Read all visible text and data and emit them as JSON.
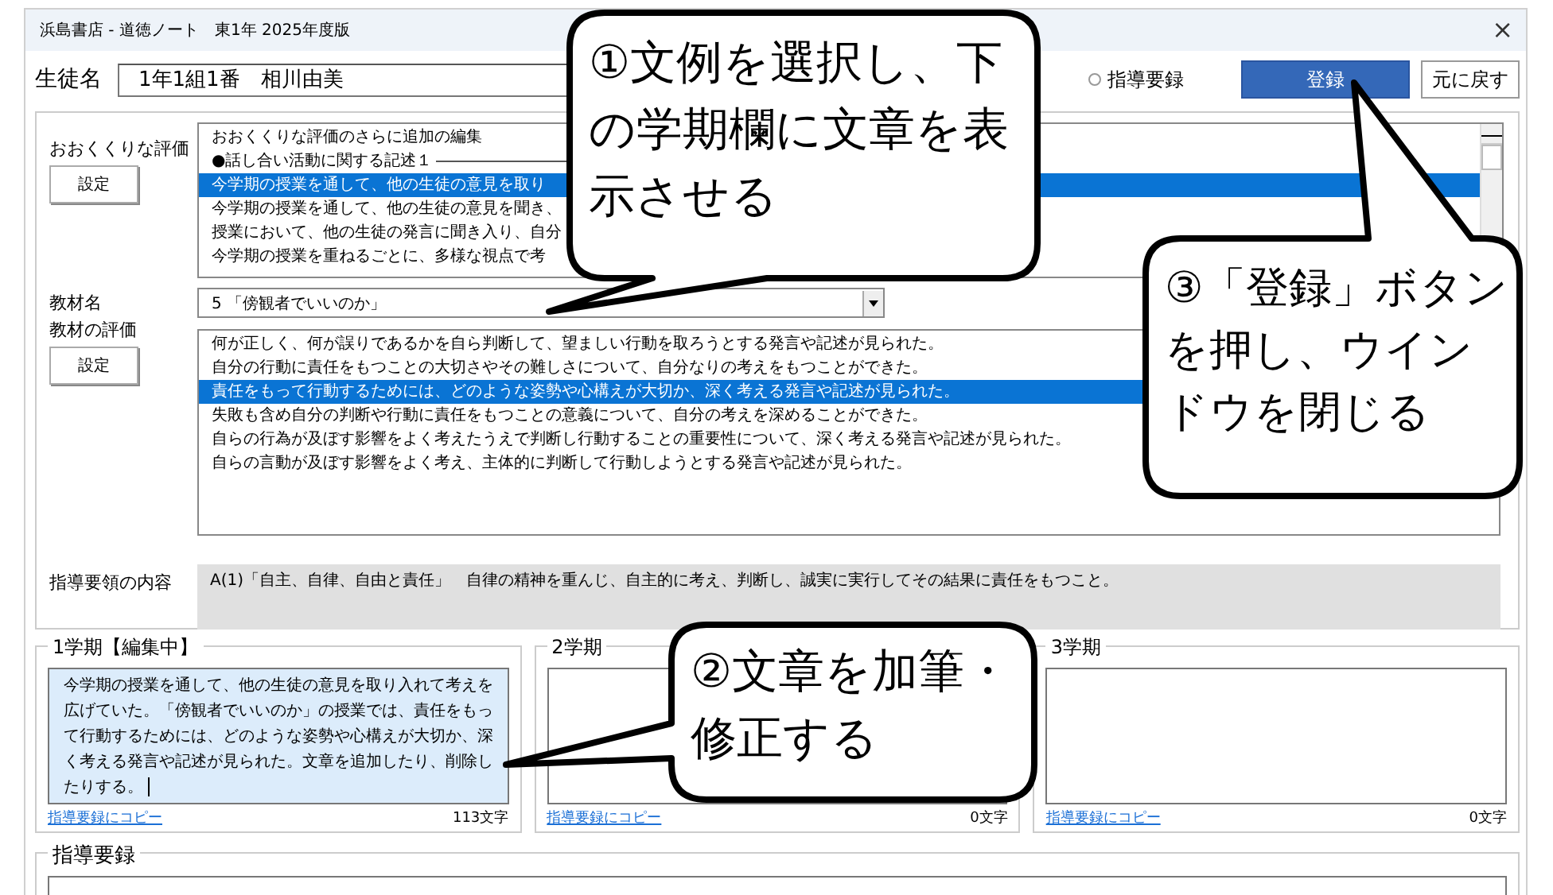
{
  "window": {
    "title": "浜島書店 - 道徳ノート　東1年 2025年度版",
    "close": "×"
  },
  "student": {
    "label": "生徒名",
    "value": "1年1組1番　相川由美"
  },
  "record_option": {
    "label": "指導要録",
    "selected": false
  },
  "buttons": [
    {
      "label": "登録",
      "kind": "primary"
    },
    {
      "label": "元に戻す",
      "kind": "normal"
    }
  ],
  "overall": {
    "label": "おおくくりな評価",
    "button": "設定",
    "items": [
      {
        "text": "おおくくりな評価のさらに追加の編集",
        "kind": "plain",
        "selected": false
      },
      {
        "text": "●話し合い活動に関する記述１",
        "kind": "group",
        "selected": false
      },
      {
        "text": "今学期の授業を通して、他の生徒の意見を取り",
        "kind": "plain",
        "selected": true
      },
      {
        "text": "今学期の授業を通して、他の生徒の意見を聞き、",
        "kind": "plain",
        "selected": false
      },
      {
        "text": "授業において、他の生徒の発言に聞き入り、自分",
        "kind": "plain",
        "selected": false
      },
      {
        "text": "今学期の授業を重ねるごとに、多様な視点で考",
        "kind": "plain",
        "selected": false
      }
    ]
  },
  "material": {
    "label": "教材名",
    "value": "5 「傍観者でいいのか」"
  },
  "material_eval": {
    "label": "教材の評価",
    "button": "設定",
    "items": [
      {
        "text": "何が正しく、何が誤りであるかを自ら判断して、望ましい行動を取ろうとする発言や記述が見られた。",
        "selected": false
      },
      {
        "text": "自分の行動に責任をもつことの大切さやその難しさについて、自分なりの考えをもつことができた。",
        "selected": false
      },
      {
        "text": "責任をもって行動するためには、どのような姿勢や心構えが大切か、深く考える発言や記述が見られた。",
        "selected": true
      },
      {
        "text": "失敗も含め自分の判断や行動に責任をもつことの意義について、自分の考えを深めることができた。",
        "selected": false
      },
      {
        "text": "自らの行為が及ぼす影響をよく考えたうえで判断し行動することの重要性について、深く考える発言や記述が見られた。",
        "selected": false
      },
      {
        "text": "自らの言動が及ぼす影響をよく考え、主体的に判断して行動しようとする発言や記述が見られた。",
        "selected": false
      }
    ]
  },
  "guideline": {
    "label": "指導要領の内容",
    "text": "A(1)「自主、自律、自由と責任」　自律の精神を重んじ、自主的に考え、判断し、誠実に実行してその結果に責任をもつこと。"
  },
  "terms": [
    {
      "title": "1学期【編集中】",
      "editing": true,
      "text": "今学期の授業を通して、他の生徒の意見を取り入れて考えを広げていた。「傍観者でいいのか」の授業では、責任をもって行動するためには、どのような姿勢や心構えが大切か、深く考える発言や記述が見られた。文章を追加したり、削除したりする。",
      "link": "指導要録にコピー",
      "count": "113文字"
    },
    {
      "title": "2学期",
      "editing": false,
      "link": "指導要録にコピー",
      "count": "0文字"
    },
    {
      "title": "3学期",
      "editing": false,
      "link": "指導要録にコピー",
      "count": "0文字"
    }
  ],
  "record": {
    "title": "指導要録"
  },
  "callouts": [
    {
      "text": "①文例を選択し、下の学期欄に文章を表示させる"
    },
    {
      "text": "②文章を加筆・修正する"
    },
    {
      "text": "③「登録」ボタンを押し、ウインドウを閉じる"
    }
  ]
}
